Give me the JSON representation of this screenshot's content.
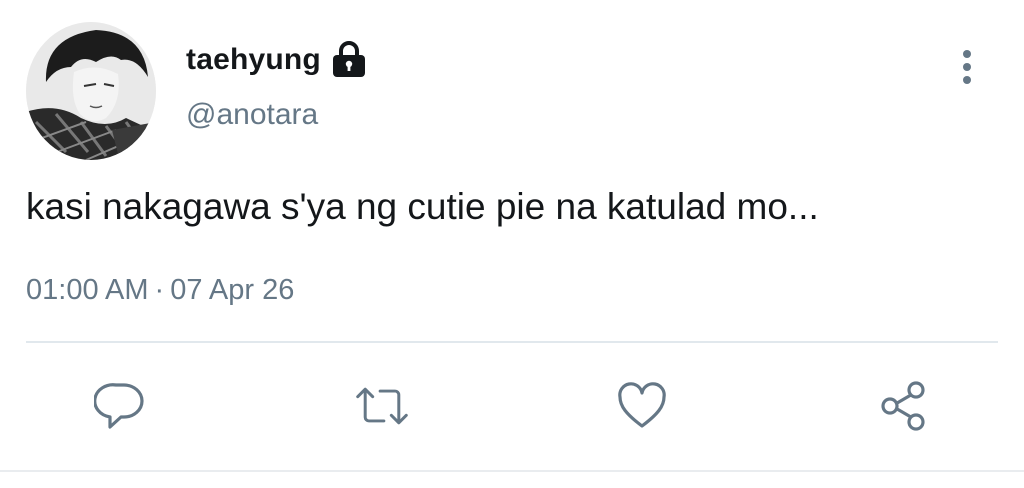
{
  "user": {
    "display_name": "taehyung",
    "handle": "@anotara",
    "protected": true
  },
  "tweet": {
    "text": "kasi nakagawa s'ya ng cutie pie na katulad mo...",
    "time": "01:00 AM",
    "separator": "·",
    "date": "07 Apr 26"
  },
  "actions": [
    {
      "name": "reply",
      "icon": "speech-bubble-icon"
    },
    {
      "name": "retweet",
      "icon": "retweet-arrows-icon"
    },
    {
      "name": "like",
      "icon": "heart-icon"
    },
    {
      "name": "share",
      "icon": "share-nodes-icon"
    }
  ],
  "colors": {
    "text_primary": "#14171a",
    "text_secondary": "#657786",
    "icon": "#657786",
    "divider": "#e1e8ed"
  }
}
